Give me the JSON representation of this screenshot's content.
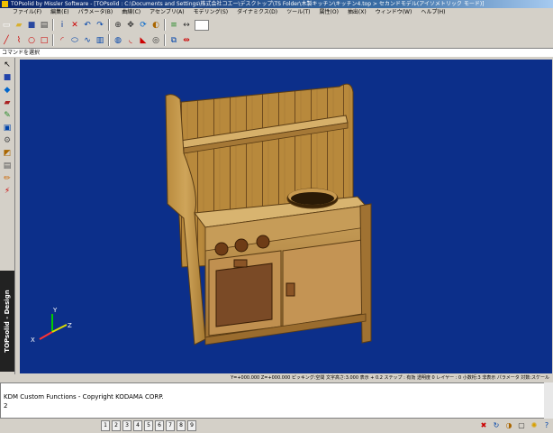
{
  "window": {
    "title": "TOPsolid by Missler Software - [TOPsolid : C:\\Documents and Settings\\株式会社コエー\\デスクトップ\\TS Folder\\木製キッチン\\キッチン4.top > セカンドモデル(アイソメトリック モード)]"
  },
  "menu": [
    "ファイル(F)",
    "編集(E)",
    "パラメータ(B)",
    "曲線(C)",
    "アセンブリ(A)",
    "モデリング(S)",
    "ダイナミクス(D)",
    "ツール(T)",
    "属性(O)",
    "抽出(X)",
    "ウィンドウ(W)",
    "ヘルプ(H)"
  ],
  "toolbar_row1": [
    {
      "icon": "new-file-icon",
      "glyph": "▭",
      "color": "#ffffff"
    },
    {
      "icon": "open-folder-icon",
      "glyph": "▰",
      "color": "#d8b030"
    },
    {
      "icon": "save-icon",
      "glyph": "■",
      "color": "#2a48a0"
    },
    {
      "icon": "print-icon",
      "glyph": "▤",
      "color": "#404040"
    },
    {
      "icon": "info-icon",
      "glyph": "i",
      "color": "#003399"
    },
    {
      "icon": "delete-icon",
      "glyph": "✕",
      "color": "#cc0000"
    },
    {
      "icon": "undo-icon",
      "glyph": "↶",
      "color": "#0044aa"
    },
    {
      "icon": "redo-icon",
      "glyph": "↷",
      "color": "#0044aa"
    },
    {
      "icon": "zoom-icon",
      "glyph": "⊕",
      "color": "#333333"
    },
    {
      "icon": "pan-icon",
      "glyph": "✥",
      "color": "#333333"
    },
    {
      "icon": "rotate-view-icon",
      "glyph": "⟳",
      "color": "#0066cc"
    },
    {
      "icon": "shading-icon",
      "glyph": "◐",
      "color": "#aa6600"
    },
    {
      "icon": "layer-icon",
      "glyph": "≡",
      "color": "#2a8a2a"
    },
    {
      "icon": "measure-icon",
      "glyph": "↔",
      "color": "#333333"
    }
  ],
  "toolbar_row2": [
    {
      "icon": "line-icon",
      "glyph": "╱",
      "color": "#cc0000"
    },
    {
      "icon": "polyline-icon",
      "glyph": "⌇",
      "color": "#cc0000"
    },
    {
      "icon": "circle-icon",
      "glyph": "○",
      "color": "#cc0000"
    },
    {
      "icon": "rectangle-icon",
      "glyph": "□",
      "color": "#cc0000"
    },
    {
      "icon": "arc-icon",
      "glyph": "◜",
      "color": "#cc0000"
    },
    {
      "icon": "ellipse-icon",
      "glyph": "⬭",
      "color": "#0044aa"
    },
    {
      "icon": "spline-icon",
      "glyph": "∿",
      "color": "#0044aa"
    },
    {
      "icon": "extrude-icon",
      "glyph": "▥",
      "color": "#0044aa"
    },
    {
      "icon": "revolve-icon",
      "glyph": "◍",
      "color": "#0044aa"
    },
    {
      "icon": "fillet-icon",
      "glyph": "◟",
      "color": "#cc0000"
    },
    {
      "icon": "chamfer-icon",
      "glyph": "◣",
      "color": "#cc0000"
    },
    {
      "icon": "hole-icon",
      "glyph": "◎",
      "color": "#333333"
    },
    {
      "icon": "boolean-icon",
      "glyph": "⧉",
      "color": "#0044aa"
    },
    {
      "icon": "mirror-icon",
      "glyph": "⇹",
      "color": "#cc0000"
    }
  ],
  "command_prompt": "コマンドを選択",
  "brand_label": "TOPsolid - Design",
  "status_bar": "Y=+000.000  Z=+000.000  ピッキング:空間  文字高さ:3.000  表示 +  0.2  ステップ :  有効  透明度 0  レイヤー :  0  小数桁:3  非表示  パラメータ  対数:スケール",
  "console": {
    "line1": "KDM Custom Functions - Copyright KODAMA CORP.",
    "line2": "2"
  },
  "page_tabs": [
    "1",
    "2",
    "3",
    "4",
    "5",
    "6",
    "7",
    "8",
    "9"
  ],
  "left_tools": [
    {
      "icon": "select-icon",
      "glyph": "↖",
      "color": "#000000"
    },
    {
      "icon": "solid-icon",
      "glyph": "■",
      "color": "#2244aa"
    },
    {
      "icon": "shape-icon",
      "glyph": "◆",
      "color": "#0066cc"
    },
    {
      "icon": "surface-icon",
      "glyph": "▰",
      "color": "#aa2222"
    },
    {
      "icon": "sketch-icon",
      "glyph": "✎",
      "color": "#2a8a2a"
    },
    {
      "icon": "part-icon",
      "glyph": "▣",
      "color": "#0044aa"
    },
    {
      "icon": "assembly-icon",
      "glyph": "⚙",
      "color": "#555555"
    },
    {
      "icon": "sheet-metal-icon",
      "glyph": "◩",
      "color": "#aa6600"
    },
    {
      "icon": "draft-icon",
      "glyph": "▤",
      "color": "#555555"
    },
    {
      "icon": "pencil-icon",
      "glyph": "✏",
      "color": "#cc6600"
    },
    {
      "icon": "weld-icon",
      "glyph": "⚡",
      "color": "#cc0000"
    }
  ],
  "bottom_icons": [
    {
      "icon": "stop-icon",
      "glyph": "✖",
      "color": "#cc0000"
    },
    {
      "icon": "rebuild-icon",
      "glyph": "↻",
      "color": "#0044aa"
    },
    {
      "icon": "shaded-view-icon",
      "glyph": "◑",
      "color": "#aa6600"
    },
    {
      "icon": "wireframe-icon",
      "glyph": "▢",
      "color": "#333333"
    },
    {
      "icon": "light-icon",
      "glyph": "✺",
      "color": "#d8a000"
    },
    {
      "icon": "help-icon",
      "glyph": "?",
      "color": "#0044aa"
    }
  ],
  "axis_labels": {
    "x": "X",
    "y": "Y",
    "z": "Z"
  },
  "colors": {
    "viewport": "#0c2f8a",
    "wood_light": "#c8a050",
    "wood_mid": "#a87a30",
    "wood_dark": "#6e4a1e",
    "title_start": "#0a246a"
  }
}
